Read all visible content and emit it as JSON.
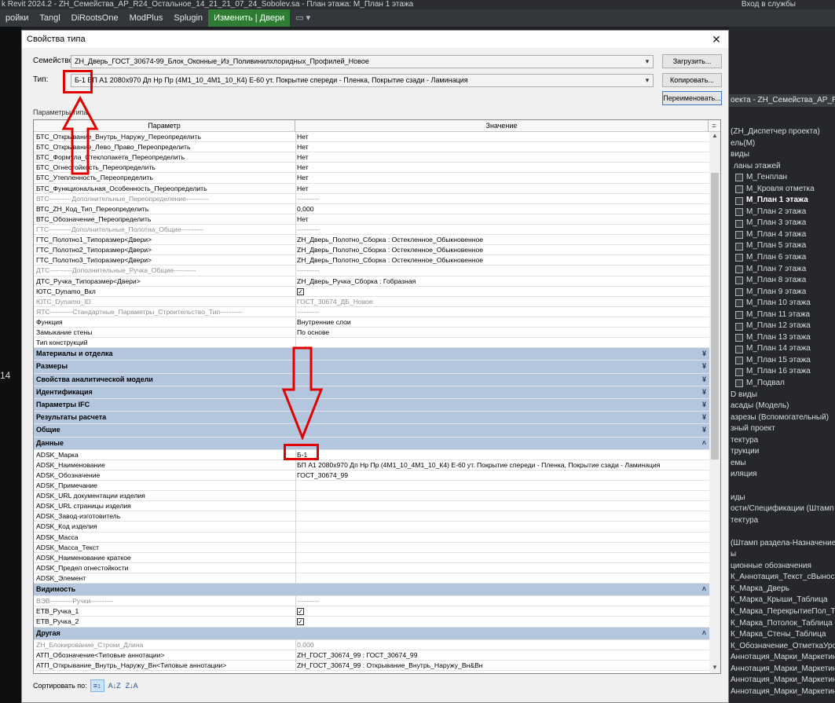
{
  "titlebar": {
    "text": "k Revit 2024.2 - ZH_Семейства_АР_R24_Остальное_14_21_21_07_24_Sobolev.sa - План этажа: М_План 1 этажа",
    "login": "Вход в службы"
  },
  "ribbon": {
    "tabs": [
      "ройки",
      "Tangl",
      "DiRootsOne",
      "ModPlus",
      "Splugin",
      "Изменить | Двери",
      "▭ ▾"
    ]
  },
  "canvas": {
    "number": "14"
  },
  "browser": {
    "header": "оекта - ZH_Семейства_АР_R24_...",
    "items": [
      {
        "text": "(ZH_Диспетчер проекта)",
        "kind": "tree"
      },
      {
        "text": "ель(М)",
        "kind": "tree"
      },
      {
        "text": "виды",
        "kind": "tree"
      },
      {
        "text": "ланы этажей",
        "kind": "sub"
      },
      {
        "text": "М_Генплан",
        "kind": "view"
      },
      {
        "text": "М_Кровля отметка",
        "kind": "view"
      },
      {
        "text": "М_План 1 этажа",
        "kind": "view",
        "bold": true
      },
      {
        "text": "М_План 2 этажа",
        "kind": "view"
      },
      {
        "text": "М_План 3 этажа",
        "kind": "view"
      },
      {
        "text": "М_План 4 этажа",
        "kind": "view"
      },
      {
        "text": "М_План 5 этажа",
        "kind": "view"
      },
      {
        "text": "М_План 6 этажа",
        "kind": "view"
      },
      {
        "text": "М_План 7 этажа",
        "kind": "view"
      },
      {
        "text": "М_План 8 этажа",
        "kind": "view"
      },
      {
        "text": "М_План 9 этажа",
        "kind": "view"
      },
      {
        "text": "М_План 10 этажа",
        "kind": "view"
      },
      {
        "text": "М_План 11 этажа",
        "kind": "view"
      },
      {
        "text": "М_План 12 этажа",
        "kind": "view"
      },
      {
        "text": "М_План 13 этажа",
        "kind": "view"
      },
      {
        "text": "М_План 14 этажа",
        "kind": "view"
      },
      {
        "text": "М_План 15 этажа",
        "kind": "view"
      },
      {
        "text": "М_План 16 этажа",
        "kind": "view"
      },
      {
        "text": "М_Подвал",
        "kind": "view"
      },
      {
        "text": "D виды",
        "kind": "tree"
      },
      {
        "text": "асады (Модель)",
        "kind": "tree"
      },
      {
        "text": "азрезы (Вспомогательный)",
        "kind": "tree"
      },
      {
        "text": "зный проект",
        "kind": "tree"
      },
      {
        "text": "тектура",
        "kind": "tree"
      },
      {
        "text": "трукции",
        "kind": "tree"
      },
      {
        "text": "емы",
        "kind": "tree"
      },
      {
        "text": "иляция",
        "kind": "tree"
      },
      {
        "text": "",
        "kind": "tree"
      },
      {
        "text": "иды",
        "kind": "tree"
      },
      {
        "text": "ости/Спецификации (Штамп р",
        "kind": "tree"
      },
      {
        "text": "тектура",
        "kind": "tree"
      },
      {
        "text": "",
        "kind": "tree"
      },
      {
        "text": "(Штамп раздела-Назначение r",
        "kind": "tree"
      },
      {
        "text": "ы",
        "kind": "tree"
      },
      {
        "text": "ционные обозначения",
        "kind": "tree"
      },
      {
        "text": "К_Аннотация_Текст_сВыноской",
        "kind": "tree"
      },
      {
        "text": "К_Марка_Дверь",
        "kind": "tree"
      },
      {
        "text": "К_Марка_Крыши_Таблица",
        "kind": "tree"
      },
      {
        "text": "К_Марка_ПерекрытиеПол_Таб",
        "kind": "tree"
      },
      {
        "text": "К_Марка_Потолок_Таблица",
        "kind": "tree"
      },
      {
        "text": "К_Марка_Стены_Таблица",
        "kind": "tree"
      },
      {
        "text": "К_Обозначение_ОтметкаУрови",
        "kind": "tree"
      },
      {
        "text": "Аннотация_Марки_Маркетинг_",
        "kind": "tree"
      },
      {
        "text": "Аннотация_Марки_Маркетинг_",
        "kind": "tree"
      },
      {
        "text": "Аннотация_Марки_Маркетинг_",
        "kind": "tree"
      },
      {
        "text": "Аннотация_Марки_Маркетинг_",
        "kind": "tree"
      }
    ]
  },
  "dialog": {
    "title": "Свойства типа",
    "family_label": "Семейство:",
    "family_value": "ZH_Дверь_ГОСТ_30674-99_Блок_Оконные_Из_Поливинилхлоридных_Профилей_Новое",
    "type_label": "Тип:",
    "type_value": "Б-1 БП А1 2080х970 Дп Нр Пр (4М1_10_4М1_10_К4) Е-60 ут.  Покрытие спереди - Пленка, Покрытие сзади - Ламинация",
    "load_button": "Загрузить...",
    "copy_button": "Копировать...",
    "rename_button": "Переименовать...",
    "params_label": "Параметры типа",
    "col_param": "Параметр",
    "col_value": "Значение",
    "col_extra": "=",
    "sort_label": "Сортировать по:",
    "sort_icons": [
      "≡↕",
      "A↓Z",
      "Z↓A"
    ]
  },
  "grid": [
    {
      "t": "row",
      "p": "БТС_Открывание_Внутрь_Наружу_Переопределить",
      "v": "Нет"
    },
    {
      "t": "row",
      "p": "БТС_Открывание_Лево_Право_Переопределить",
      "v": "Нет"
    },
    {
      "t": "row",
      "p": "БТС_Формула_Стеклопакета_Переопределить",
      "v": "Нет"
    },
    {
      "t": "row",
      "p": "БТС_Огнестойкость_Переопределить",
      "v": "Нет"
    },
    {
      "t": "row",
      "p": "БТС_Утепленность_Переопределить",
      "v": "Нет"
    },
    {
      "t": "row",
      "p": "БТС_Функциональная_Особенность_Переопределить",
      "v": "Нет"
    },
    {
      "t": "grey",
      "p": "ВТС----------Дополнительные_Переопределение----------",
      "v": "----------"
    },
    {
      "t": "row",
      "p": "ВТС_ZH_Код_Тип_Переопределить",
      "v": "0,000"
    },
    {
      "t": "row",
      "p": "ВТС_Обозначение_Переопределить",
      "v": "Нет"
    },
    {
      "t": "grey",
      "p": "ГТС----------Дополнительные_Полотна_Общие----------",
      "v": "----------"
    },
    {
      "t": "row",
      "p": "ГТС_Полотно1_Типоразмер<Двери>",
      "v": "ZH_Дверь_Полотно_Сборка : Остекленное_Обыкновенное"
    },
    {
      "t": "row",
      "p": "ГТС_Полотно2_Типоразмер<Двери>",
      "v": "ZH_Дверь_Полотно_Сборка : Остекленное_Обыкновенное"
    },
    {
      "t": "row",
      "p": "ГТС_Полотно3_Типоразмер<Двери>",
      "v": "ZH_Дверь_Полотно_Сборка : Остекленное_Обыкновенное"
    },
    {
      "t": "grey",
      "p": "ДТС----------Дополнительные_Ручка_Общие----------",
      "v": "----------"
    },
    {
      "t": "row",
      "p": "ДТС_Ручка_Типоразмер<Двери>",
      "v": "ZH_Дверь_Ручка_Сборка : Гобразная"
    },
    {
      "t": "check",
      "p": "ЮТС_Dynamo_Вкл",
      "v": "✓"
    },
    {
      "t": "grey",
      "p": "ЮТС_Dynamo_ID",
      "v": "ГОСТ_30674_ДБ_Новое"
    },
    {
      "t": "grey",
      "p": "ЯТС----------Стандартные_Параметры_Строительство_Тип----------",
      "v": "----------"
    },
    {
      "t": "row",
      "p": "Функция",
      "v": "Внутренние слои"
    },
    {
      "t": "row",
      "p": "Замыкание стены",
      "v": "По основе"
    },
    {
      "t": "row",
      "p": "Тип конструкций",
      "v": ""
    },
    {
      "t": "group",
      "p": "Материалы и отделка",
      "v": "¥"
    },
    {
      "t": "group",
      "p": "Размеры",
      "v": "¥"
    },
    {
      "t": "group",
      "p": "Свойства аналитической модели",
      "v": "¥"
    },
    {
      "t": "group",
      "p": "Идентификация",
      "v": "¥"
    },
    {
      "t": "group",
      "p": "Параметры IFC",
      "v": "¥"
    },
    {
      "t": "group",
      "p": "Результаты расчета",
      "v": "¥"
    },
    {
      "t": "group",
      "p": "Общие",
      "v": "¥"
    },
    {
      "t": "group",
      "p": "Данные",
      "v": "˄"
    },
    {
      "t": "row",
      "p": "ADSK_Марка",
      "v": "Б-1"
    },
    {
      "t": "row",
      "p": "ADSK_Наименование",
      "v": "БП А1 2080х970 Дп Нр Пр (4М1_10_4М1_10_К4) Е-60 ут.  Покрытие спереди - Пленка, Покрытие сзади - Ламинация"
    },
    {
      "t": "row",
      "p": "ADSK_Обозначение",
      "v": "ГОСТ_30674_99"
    },
    {
      "t": "row",
      "p": "ADSK_Примечание",
      "v": ""
    },
    {
      "t": "row",
      "p": "ADSK_URL документации изделия",
      "v": ""
    },
    {
      "t": "row",
      "p": "ADSK_URL страницы изделия",
      "v": ""
    },
    {
      "t": "row",
      "p": "ADSK_Завод-изготовитель",
      "v": ""
    },
    {
      "t": "row",
      "p": "ADSK_Код изделия",
      "v": ""
    },
    {
      "t": "row",
      "p": "ADSK_Масса",
      "v": ""
    },
    {
      "t": "row",
      "p": "ADSK_Масса_Текст",
      "v": ""
    },
    {
      "t": "row",
      "p": "ADSK_Наименование краткое",
      "v": ""
    },
    {
      "t": "row",
      "p": "ADSK_Предел огнестойкости",
      "v": ""
    },
    {
      "t": "row",
      "p": "ADSK_Элемент",
      "v": ""
    },
    {
      "t": "group",
      "p": "Видимость",
      "v": "˄"
    },
    {
      "t": "grey",
      "p": "ВЭВ----------Ручки----------",
      "v": "----------"
    },
    {
      "t": "check",
      "p": "ЕТВ_Ручка_1",
      "v": "✓"
    },
    {
      "t": "check",
      "p": "ЕТВ_Ручка_2",
      "v": "✓"
    },
    {
      "t": "group",
      "p": "Другая",
      "v": "˄"
    },
    {
      "t": "grey",
      "p": "ZH_Блокирование_Строки_Длина",
      "v": "0,000"
    },
    {
      "t": "row",
      "p": "АТП_Обозначение<Типовые аннотации>",
      "v": "ZH_ГОСТ_30674_99 : ГОСТ_30674_99"
    },
    {
      "t": "row",
      "p": "АТП_Открывание_Внутрь_Наружу_Вн<Типовые аннотации>",
      "v": "ZH_ГОСТ_30674_99 : Открывание_Внутрь_Наружу_Вн&Вн"
    }
  ],
  "colors": {
    "group_bg": "#b3c6dd",
    "annotation": "#e00000",
    "active_tab": "#2e7d32"
  }
}
